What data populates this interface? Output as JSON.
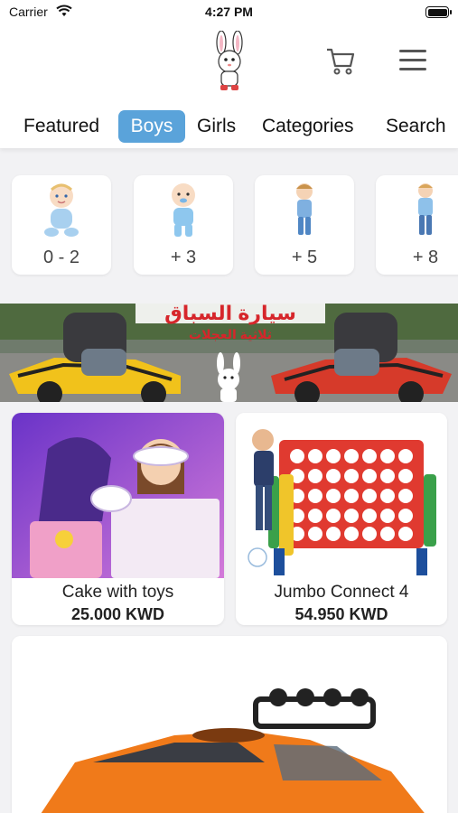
{
  "status": {
    "carrier": "Carrier",
    "time": "4:27 PM"
  },
  "header": {
    "logo": "bunny-logo",
    "cart_icon": "cart-icon",
    "menu_icon": "menu-icon"
  },
  "tabs": [
    {
      "label": "Featured",
      "active": false
    },
    {
      "label": "Boys",
      "active": true
    },
    {
      "label": "Girls",
      "active": false
    },
    {
      "label": "Categories",
      "active": false
    },
    {
      "label": "Search",
      "active": false
    }
  ],
  "ages": [
    {
      "label": "0 - 2",
      "icon": "baby-icon"
    },
    {
      "label": "+ 3",
      "icon": "toddler-icon"
    },
    {
      "label": "+ 5",
      "icon": "boy-icon"
    },
    {
      "label": "+ 8",
      "icon": "older-boy-icon"
    }
  ],
  "banner": {
    "title": "سيارة السباق",
    "subtitle": "ثلاثية العجلات"
  },
  "products": [
    {
      "name": "Cake with toys",
      "price": "25.000 KWD"
    },
    {
      "name": "Jumbo Connect 4",
      "price": "54.950 KWD"
    }
  ],
  "colors": {
    "accent": "#5aa3da",
    "background": "#f2f2f4"
  }
}
